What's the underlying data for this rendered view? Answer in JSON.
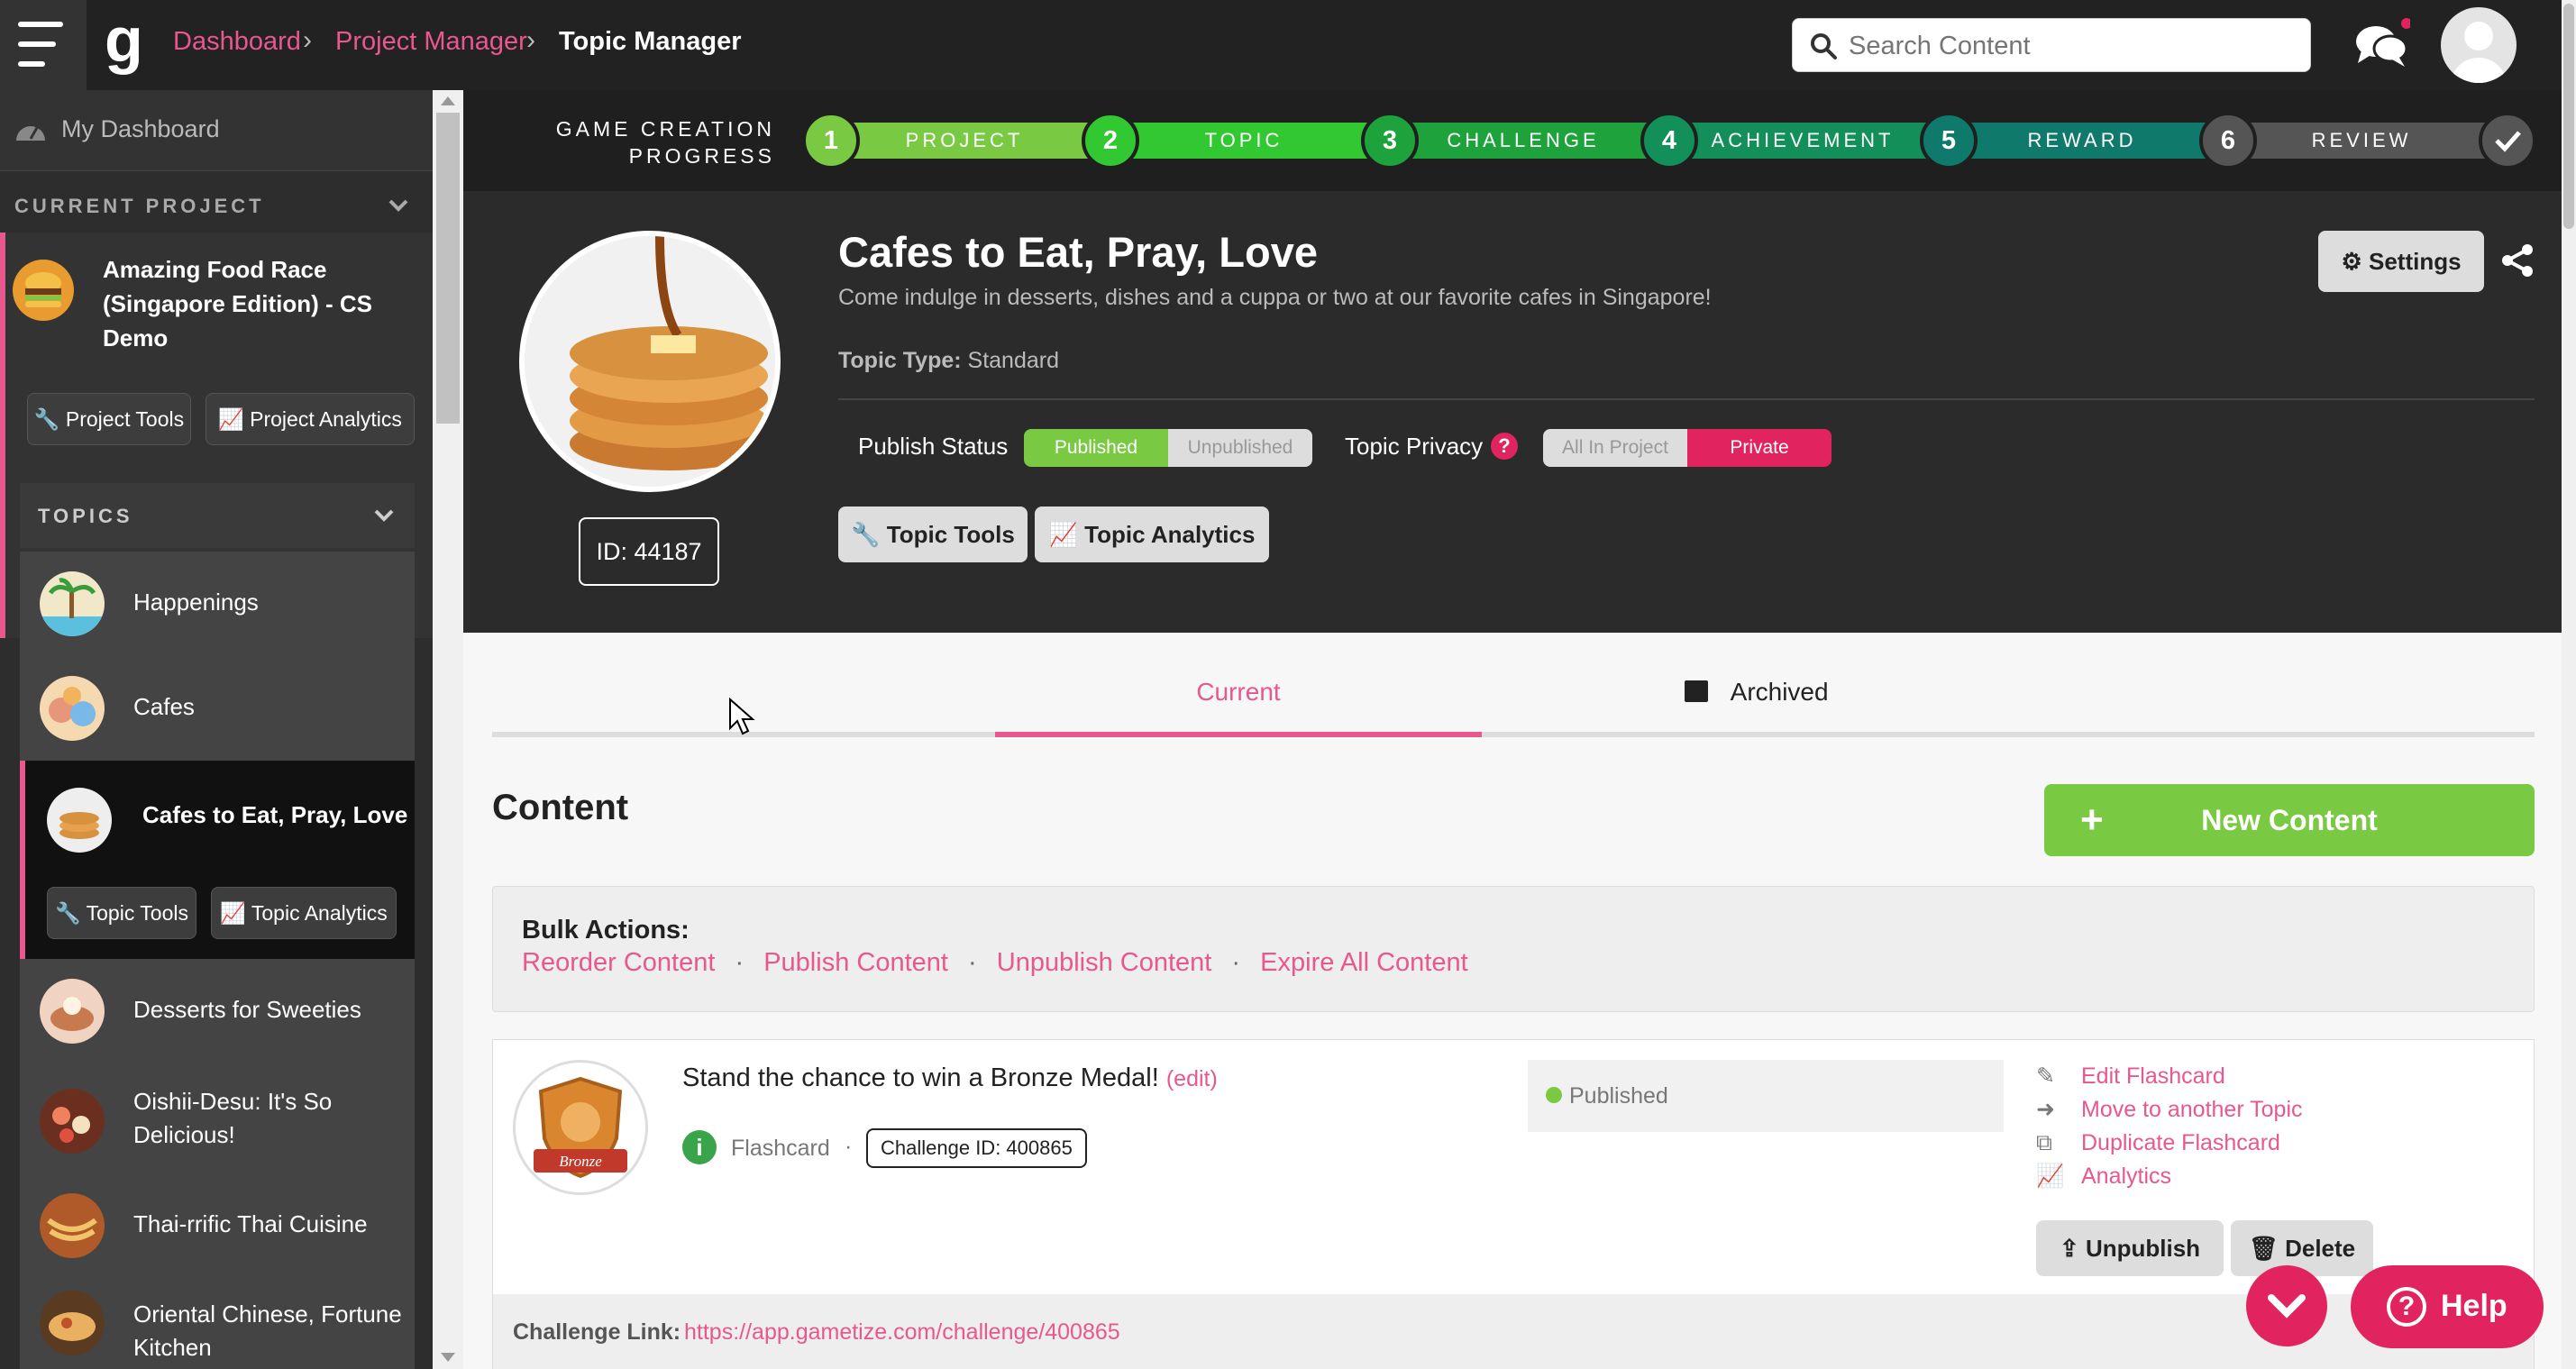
{
  "topbar": {
    "breadcrumb": [
      "Dashboard",
      "Project Manager",
      "Topic Manager"
    ],
    "search_placeholder": "Search Content",
    "icons": [
      "menu-icon",
      "logo",
      "search-icon",
      "chat-icon",
      "avatar"
    ]
  },
  "sidebar": {
    "dashboard_label": "My Dashboard",
    "current_project_label": "CURRENT PROJECT",
    "project_name_lines": [
      "Amazing Food Race",
      "(Singapore Edition) - CS",
      "Demo"
    ],
    "project_tools": "Project Tools",
    "project_analytics": "Project Analytics",
    "topics_label": "TOPICS",
    "topics": [
      {
        "name": "Happenings"
      },
      {
        "name": "Cafes"
      },
      {
        "name": "Cafes to Eat, Pray, Love",
        "active": true
      },
      {
        "name": "Desserts for Sweeties"
      },
      {
        "name_lines": [
          "Oishii-Desu: It's So",
          "Delicious!"
        ]
      },
      {
        "name": "Thai-rrific Thai Cuisine"
      },
      {
        "name_lines": [
          "Oriental Chinese, Fortune",
          "Kitchen"
        ]
      }
    ],
    "topic_tools": "Topic Tools",
    "topic_analytics": "Topic Analytics"
  },
  "progress": {
    "label_lines": [
      "GAME CREATION",
      "PROGRESS"
    ],
    "steps": [
      {
        "num": "1",
        "label": "PROJECT",
        "color": "#7ac943"
      },
      {
        "num": "2",
        "label": "TOPIC",
        "color": "#32c832"
      },
      {
        "num": "3",
        "label": "CHALLENGE",
        "color": "#1ea33c"
      },
      {
        "num": "4",
        "label": "ACHIEVEMENT",
        "color": "#138f5a"
      },
      {
        "num": "5",
        "label": "REWARD",
        "color": "#0f7a6b"
      },
      {
        "num": "6",
        "label": "REVIEW",
        "color": "#555555"
      }
    ]
  },
  "topic": {
    "title": "Cafes to Eat, Pray, Love",
    "description": "Come indulge in desserts, dishes and a cuppa or two at our favorite cafes in Singapore!",
    "type_label": "Topic Type:",
    "type_value": "Standard",
    "id_label": "ID: 44187",
    "settings": "Settings",
    "publish_status_label": "Publish Status",
    "published": "Published",
    "unpublished": "Unpublished",
    "privacy_label": "Topic Privacy",
    "privacy_all": "All In Project",
    "privacy_private": "Private",
    "topic_tools": "Topic Tools",
    "topic_analytics": "Topic Analytics"
  },
  "tabs": {
    "current": "Current",
    "archived": "Archived"
  },
  "content": {
    "heading": "Content",
    "new_content": "New Content",
    "bulk_label": "Bulk Actions:",
    "bulk_actions": [
      "Reorder Content",
      "Publish Content",
      "Unpublish Content",
      "Expire All Content"
    ],
    "separator": "·"
  },
  "card": {
    "title": "Stand the chance to win a Bronze Medal!",
    "edit": "(edit)",
    "type": "Flashcard",
    "challenge_id": "Challenge ID: 400865",
    "status": "Published",
    "badge_text": "Bronze",
    "actions": [
      "Edit Flashcard",
      "Move to another Topic",
      "Duplicate Flashcard",
      "Analytics"
    ],
    "unpublish": "Unpublish",
    "delete": "Delete",
    "link_label": "Challenge Link:",
    "link_url": "https://app.gametize.com/challenge/400865"
  },
  "help": "Help",
  "colors": {
    "accent_pink": "#e8578e",
    "green": "#7ac943",
    "private_red": "#e1245f"
  }
}
